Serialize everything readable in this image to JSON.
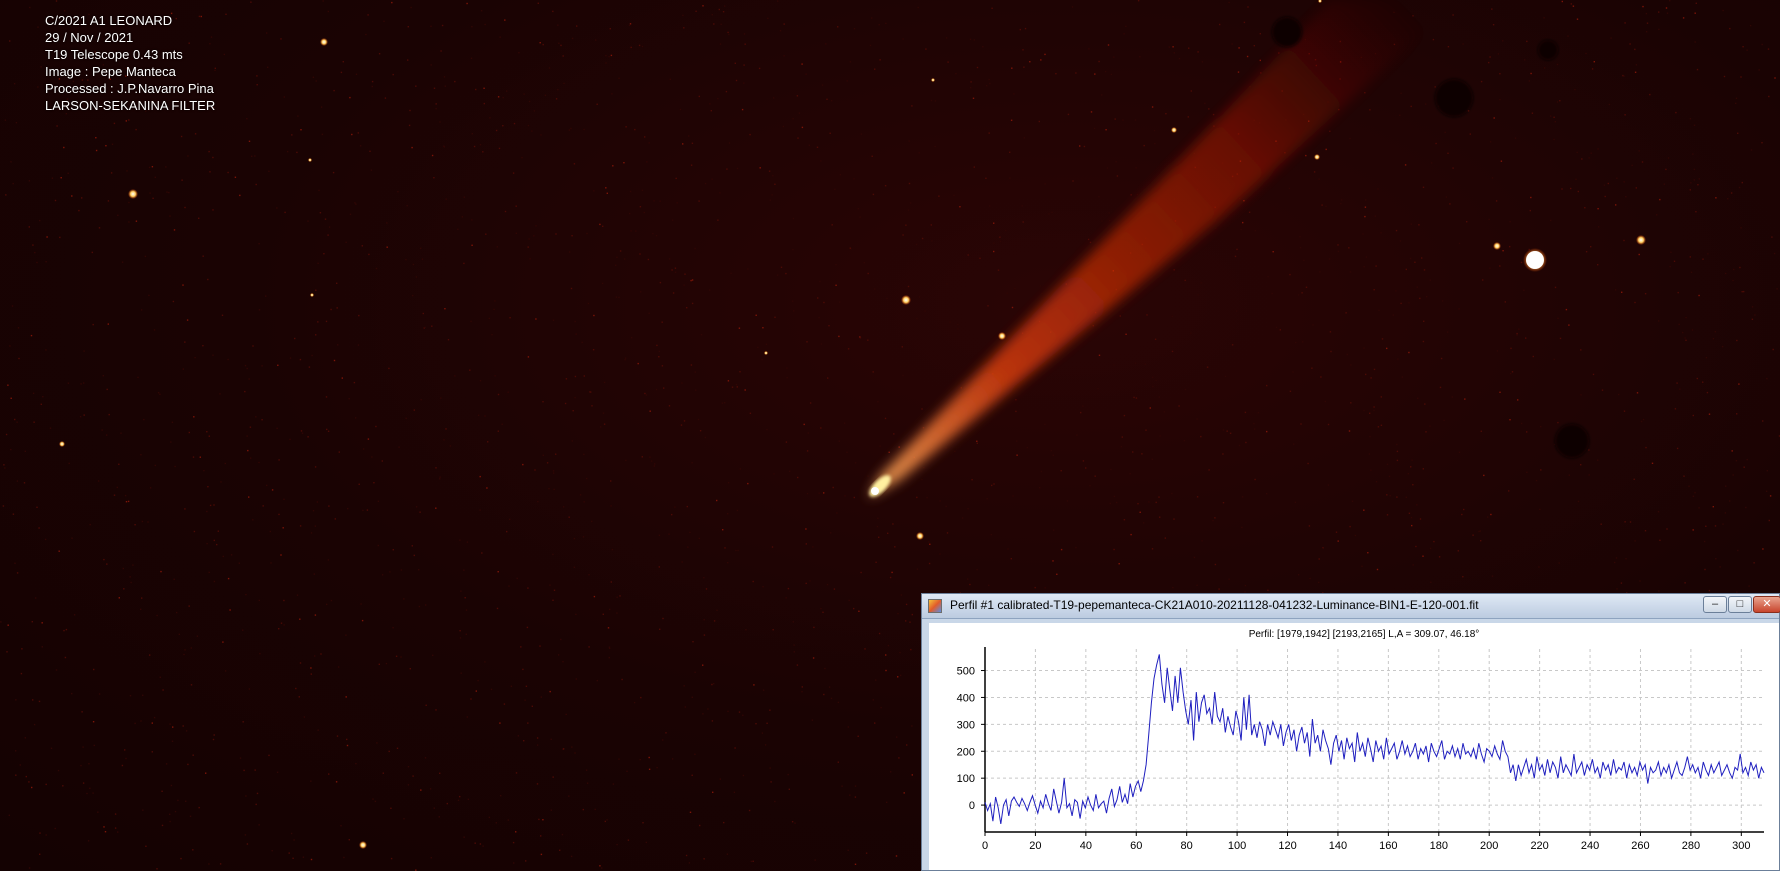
{
  "caption": {
    "line1": "C/2021 A1 LEONARD",
    "line2": "29 / Nov / 2021",
    "line3": "T19 Telescope 0.43 mts",
    "line4": "Image : Pepe Manteca",
    "line5": "Processed : J.P.Navarro Pina",
    "line6": "LARSON-SEKANINA FILTER"
  },
  "window": {
    "title": "Perfil #1 calibrated-T19-pepemanteca-CK21A010-20211128-041232-Luminance-BIN1-E-120-001.fit",
    "minimize_label": "–",
    "maximize_label": "□",
    "close_label": "✕"
  },
  "colors": {
    "sky": "#1a0303",
    "comet_core": "#fff4b0",
    "comet_tail": "#ff3a00",
    "series_line": "#1f1fbf"
  },
  "chart_data": {
    "type": "line",
    "title": "Perfil: [1979,1942] [2193,2165]  L,A = 309.07, 46.18°",
    "xlabel": "",
    "ylabel": "",
    "xlim": [
      0,
      309
    ],
    "ylim": [
      -100,
      580
    ],
    "x_ticks": [
      0,
      20,
      40,
      60,
      80,
      100,
      120,
      140,
      160,
      180,
      200,
      220,
      240,
      260,
      280,
      300
    ],
    "y_ticks": [
      0,
      100,
      200,
      300,
      400,
      500
    ],
    "grid": true,
    "series": [
      {
        "values": [
          10,
          -20,
          5,
          -60,
          30,
          -10,
          -70,
          0,
          20,
          -40,
          15,
          30,
          10,
          -5,
          25,
          5,
          -20,
          10,
          35,
          0,
          -30,
          15,
          -10,
          40,
          5,
          -20,
          60,
          15,
          -30,
          10,
          100,
          -10,
          5,
          -40,
          20,
          10,
          -50,
          15,
          -10,
          30,
          0,
          -20,
          40,
          -10,
          5,
          15,
          -30,
          25,
          60,
          -5,
          20,
          70,
          10,
          40,
          5,
          80,
          30,
          70,
          90,
          50,
          90,
          150,
          260,
          380,
          470,
          520,
          560,
          450,
          380,
          510,
          430,
          350,
          480,
          380,
          510,
          420,
          350,
          300,
          390,
          240,
          420,
          310,
          380,
          410,
          340,
          360,
          300,
          420,
          330,
          310,
          360,
          270,
          330,
          290,
          260,
          350,
          310,
          240,
          400,
          280,
          410,
          260,
          300,
          250,
          310,
          280,
          220,
          300,
          260,
          310,
          280,
          250,
          300,
          220,
          270,
          300,
          240,
          280,
          200,
          260,
          290,
          230,
          270,
          180,
          320,
          230,
          260,
          200,
          280,
          240,
          210,
          150,
          230,
          260,
          200,
          240,
          170,
          250,
          210,
          230,
          160,
          270,
          200,
          230,
          180,
          250,
          210,
          160,
          240,
          200,
          220,
          170,
          250,
          190,
          210,
          230,
          170,
          200,
          240,
          190,
          220,
          180,
          200,
          230,
          170,
          210,
          190,
          220,
          160,
          230,
          200,
          180,
          210,
          240,
          170,
          200,
          190,
          220,
          180,
          210,
          170,
          230,
          190,
          200,
          180,
          210,
          170,
          230,
          190,
          160,
          210,
          200,
          180,
          220,
          190,
          170,
          240,
          200,
          180,
          120,
          150,
          90,
          150,
          110,
          140,
          170,
          120,
          150,
          100,
          180,
          130,
          150,
          110,
          170,
          120,
          160,
          140,
          100,
          180,
          120,
          150,
          130,
          110,
          190,
          120,
          140,
          160,
          110,
          150,
          130,
          170,
          120,
          140,
          100,
          160,
          130,
          150,
          110,
          170,
          120,
          140,
          130,
          160,
          100,
          150,
          120,
          140,
          110,
          160,
          130,
          150,
          80,
          140,
          120,
          130,
          160,
          110,
          140,
          120,
          150,
          100,
          130,
          160,
          120,
          110,
          140,
          180,
          130,
          150,
          120,
          140,
          100,
          160,
          130,
          110,
          150,
          120,
          140,
          160,
          110,
          130,
          150,
          120,
          100,
          140,
          130,
          190,
          120,
          140,
          110,
          160,
          130,
          150,
          100,
          140,
          120
        ]
      }
    ]
  }
}
